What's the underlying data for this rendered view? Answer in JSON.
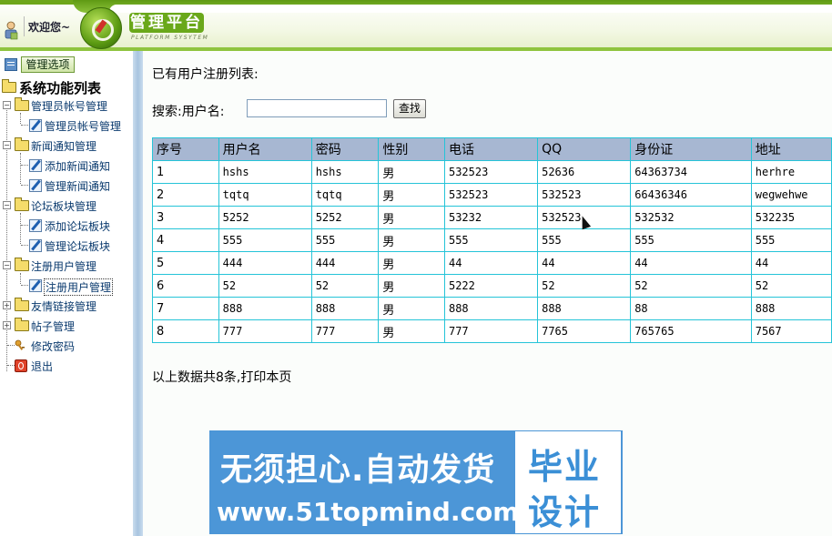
{
  "header": {
    "welcome": "欢迎您~",
    "brand": "管理平台",
    "brand_sub": "PLATFORM SYSYTEM"
  },
  "sidebar": {
    "options_button": "管理选项",
    "root": "系统功能列表",
    "groups": [
      {
        "label": "管理员帐号管理",
        "items": [
          "管理员帐号管理"
        ]
      },
      {
        "label": "新闻通知管理",
        "items": [
          "添加新闻通知",
          "管理新闻通知"
        ]
      },
      {
        "label": "论坛板块管理",
        "items": [
          "添加论坛板块",
          "管理论坛板块"
        ]
      },
      {
        "label": "注册用户管理",
        "items": [
          "注册用户管理"
        ]
      },
      {
        "label": "友情链接管理",
        "items": []
      },
      {
        "label": "帖子管理",
        "items": []
      }
    ],
    "change_password": "修改密码",
    "logout": "退出"
  },
  "main": {
    "caption": "已有用户注册列表:",
    "search_label": "搜索:用户名:",
    "search_value": "",
    "search_button": "查找",
    "columns": [
      "序号",
      "用户名",
      "密码",
      "性别",
      "电话",
      "QQ",
      "身份证",
      "地址"
    ],
    "rows": [
      [
        "1",
        "hshs",
        "hshs",
        "男",
        "532523",
        "52636",
        "64363734",
        "herhre"
      ],
      [
        "2",
        "tqtq",
        "tqtq",
        "男",
        "532523",
        "532523",
        "66436346",
        "wegwehwe"
      ],
      [
        "3",
        "5252",
        "5252",
        "男",
        "53232",
        "532523",
        "532532",
        "532235"
      ],
      [
        "4",
        "555",
        "555",
        "男",
        "555",
        "555",
        "555",
        "555"
      ],
      [
        "5",
        "444",
        "444",
        "男",
        "44",
        "44",
        "44",
        "44"
      ],
      [
        "6",
        "52",
        "52",
        "男",
        "5222",
        "52",
        "52",
        "52"
      ],
      [
        "7",
        "888",
        "888",
        "男",
        "888",
        "888",
        "88",
        "888"
      ],
      [
        "8",
        "777",
        "777",
        "男",
        "777",
        "7765",
        "765765",
        "7567"
      ]
    ],
    "footer": "以上数据共8条,打印本页"
  },
  "banner": {
    "line1": "无须担心.自动发货",
    "line2": "www.51topmind.com",
    "box_line1": "毕业",
    "box_line2": "设计"
  },
  "colors": {
    "header_green": "#6ea61a",
    "table_header": "#a7b7d2",
    "table_border": "#25c4d8",
    "banner_blue": "#4c96d7"
  }
}
